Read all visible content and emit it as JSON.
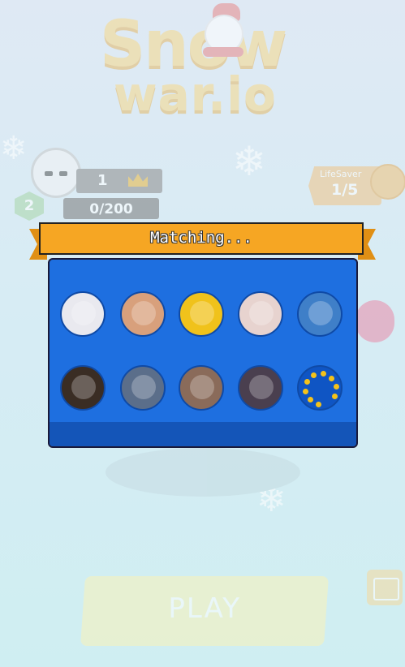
{
  "logo": {
    "line1": "Snow",
    "line2": "war.io"
  },
  "player": {
    "rank": "1",
    "xp": "0/200",
    "level": "2"
  },
  "lifesaver": {
    "label": "LifeSaver",
    "count": "1/5"
  },
  "matching": {
    "title": "Matching...",
    "slots": [
      {
        "name": "player-avatar-snowman",
        "filled": true,
        "color": "#e9e9ef"
      },
      {
        "name": "player-avatar-anime",
        "filled": true,
        "color": "#d8a07c"
      },
      {
        "name": "player-avatar-compass",
        "filled": true,
        "color": "#f0c21b"
      },
      {
        "name": "player-avatar-puppy-pink",
        "filled": true,
        "color": "#e7d3cf"
      },
      {
        "name": "player-avatar-tree",
        "filled": true,
        "color": "#3f7fc8"
      },
      {
        "name": "player-avatar-pomeranian",
        "filled": true,
        "color": "#3a2d24"
      },
      {
        "name": "player-avatar-atv",
        "filled": true,
        "color": "#5b6e8a"
      },
      {
        "name": "player-avatar-landscape",
        "filled": true,
        "color": "#8a6b5a"
      },
      {
        "name": "player-avatar-dogs",
        "filled": true,
        "color": "#4a3f4f"
      },
      {
        "name": "loading-spinner",
        "filled": false,
        "color": "#0f55c4"
      }
    ]
  },
  "play_button": {
    "label": "PLAY"
  },
  "colors": {
    "panel": "#1e6fe0",
    "banner": "#f6a623",
    "spinner_dot": "#f4c21a"
  }
}
